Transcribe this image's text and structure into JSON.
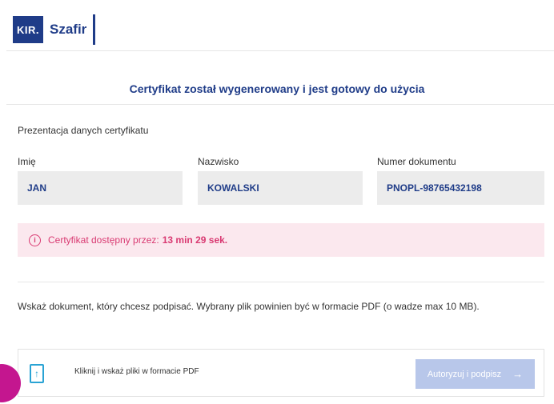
{
  "header": {
    "logo_box_text": "KIR.",
    "logo_text": "Szafir"
  },
  "main": {
    "headline": "Certyfikat został wygenerowany i jest gotowy do użycia",
    "section_label": "Prezentacja danych certyfikatu",
    "fields": [
      {
        "label": "Imię",
        "value": "JAN"
      },
      {
        "label": "Nazwisko",
        "value": "KOWALSKI"
      },
      {
        "label": "Numer dokumentu",
        "value": "PNOPL-98765432198"
      }
    ],
    "alert": {
      "icon": "info-icon",
      "icon_glyph": "i",
      "text": "Certyfikat dostępny przez:",
      "time": "13 min 29 sek."
    },
    "instruction": "Wskaż dokument, który chcesz podpisać. Wybrany plik powinien być w formacie PDF (o wadze max 10 MB).",
    "upload": {
      "icon": "upload-file-icon",
      "icon_glyph": "↑",
      "text": "Kliknij i wskaż pliki w formacie PDF",
      "button_label": "Autoryzuj i podpisz",
      "button_arrow": "→"
    }
  },
  "colors": {
    "brand": "#1f3c88",
    "alert_text": "#d93a72",
    "alert_bg": "#fbe8ee",
    "button_disabled": "#b8c7ea",
    "accent_circle": "#c4168f"
  }
}
